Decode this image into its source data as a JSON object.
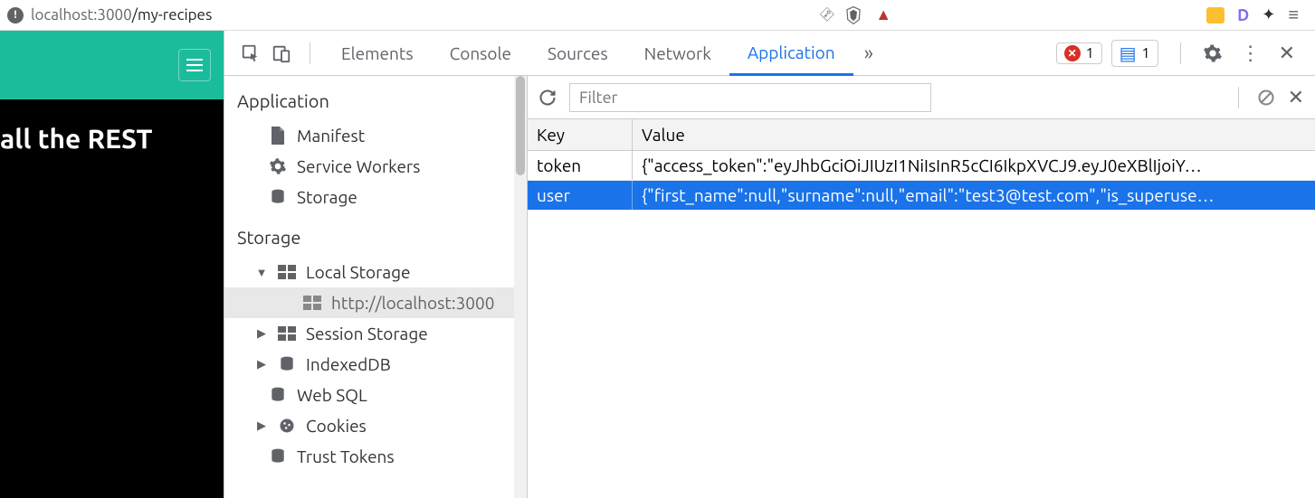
{
  "address_bar": {
    "url_host": "localhost",
    "url_port": ":3000",
    "url_path": "/my-recipes"
  },
  "page": {
    "hero_text": "all the REST"
  },
  "devtools": {
    "tabs": [
      "Elements",
      "Console",
      "Sources",
      "Network",
      "Application"
    ],
    "active_tab": "Application",
    "errors_count": "1",
    "messages_count": "1"
  },
  "sidebar": {
    "sections": {
      "application": {
        "label": "Application",
        "items": [
          {
            "label": "Manifest",
            "icon": "file"
          },
          {
            "label": "Service Workers",
            "icon": "gear"
          },
          {
            "label": "Storage",
            "icon": "db"
          }
        ]
      },
      "storage": {
        "label": "Storage",
        "items": [
          {
            "label": "Local Storage",
            "icon": "grid",
            "expanded": true,
            "children": [
              {
                "label": "http://localhost:3000",
                "icon": "grid",
                "selected": true
              }
            ]
          },
          {
            "label": "Session Storage",
            "icon": "grid",
            "expanded": false
          },
          {
            "label": "IndexedDB",
            "icon": "db",
            "expanded": false
          },
          {
            "label": "Web SQL",
            "icon": "db",
            "expanded": null
          },
          {
            "label": "Cookies",
            "icon": "cookie",
            "expanded": false
          },
          {
            "label": "Trust Tokens",
            "icon": "db",
            "expanded": null
          }
        ]
      }
    }
  },
  "storage_toolbar": {
    "filter_placeholder": "Filter"
  },
  "storage_table": {
    "headers": {
      "key": "Key",
      "value": "Value"
    },
    "rows": [
      {
        "key": "token",
        "value": "{\"access_token\":\"eyJhbGciOiJIUzI1NiIsInR5cCI6IkpXVCJ9.eyJ0eXBlIjoiY…",
        "selected": false
      },
      {
        "key": "user",
        "value": "{\"first_name\":null,\"surname\":null,\"email\":\"test3@test.com\",\"is_superuse…",
        "selected": true
      }
    ]
  }
}
